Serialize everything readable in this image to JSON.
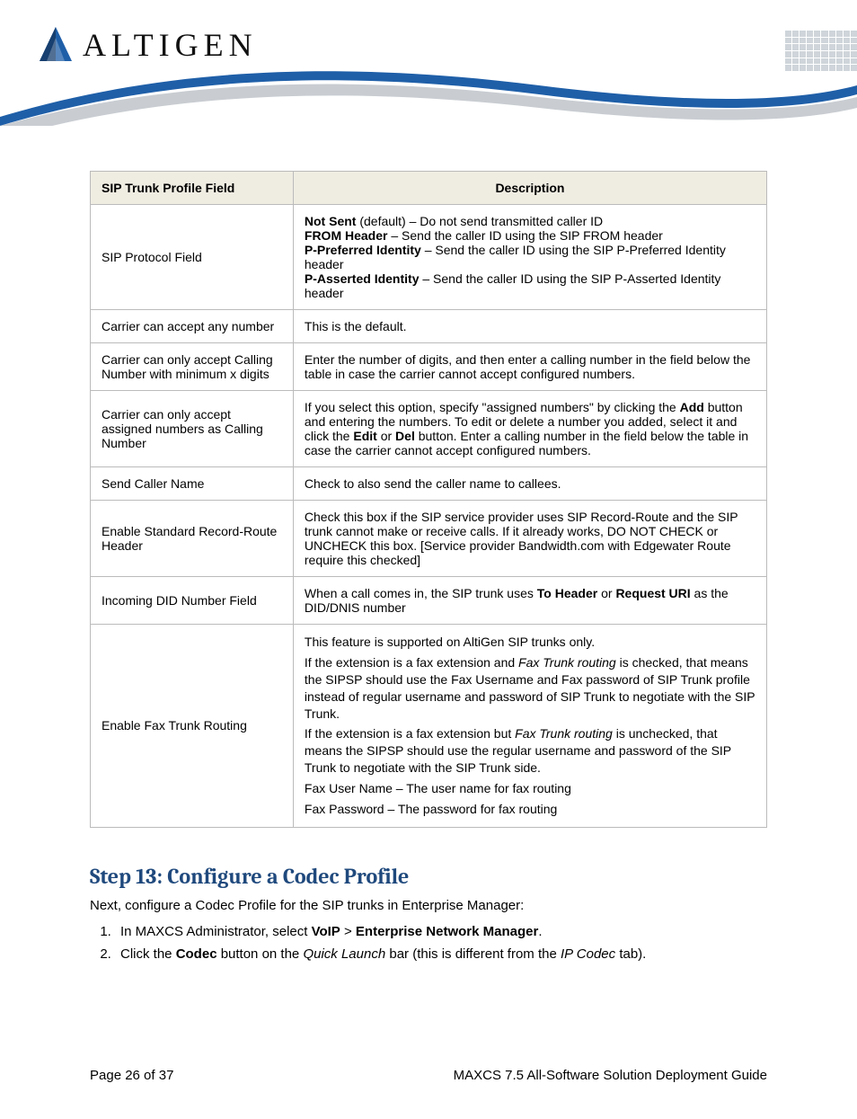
{
  "brand": {
    "name": "ALTIGEN"
  },
  "table": {
    "headers": [
      "SIP Trunk Profile Field",
      "Description"
    ],
    "rows": [
      {
        "field": "SIP Protocol Field",
        "desc": "<b>Not Sent</b> (default) – Do not send transmitted caller ID<br><b>FROM Header</b> – Send the caller ID using the SIP FROM header<br><b>P-Preferred Identity</b> – Send the caller ID using the SIP P-Preferred Identity header<br><b>P-Asserted Identity</b> – Send the caller ID using the SIP P-Asserted Identity header"
      },
      {
        "field": "Carrier can accept any number",
        "desc": "This is the default."
      },
      {
        "field": "Carrier can only accept Calling Number with minimum x digits",
        "desc": "Enter the number of digits, and then enter a calling number in the field below the table in case the carrier cannot accept configured numbers."
      },
      {
        "field": "Carrier can only accept assigned numbers as Calling Number",
        "desc": "If you select this option, specify \"assigned numbers\" by clicking the <b>Add</b> button and entering the numbers. To edit or delete a number you added, select it and click the <b>Edit</b> or <b>Del</b> button. Enter a calling number in the field below the table in case the carrier cannot accept configured numbers."
      },
      {
        "field": "Send Caller Name",
        "desc": "Check to also send the caller name to callees."
      },
      {
        "field": "Enable Standard Record-Route Header",
        "desc": "Check this box if the SIP service provider uses SIP Record-Route and the SIP trunk cannot make or receive calls. If it already works, DO NOT CHECK or UNCHECK this box. [Service provider Bandwidth.com with Edgewater Route require this checked]"
      },
      {
        "field": "Incoming DID Number Field",
        "desc": "When a call comes in, the SIP trunk uses <b>To Header</b> or <b>Request URI</b> as the DID/DNIS number"
      },
      {
        "field": "Enable Fax Trunk Routing",
        "desc": "<p>This feature is supported on AltiGen SIP trunks only.</p><p>If the extension is a fax extension and <i>Fax Trunk routing</i> is checked, that means the SIPSP should use the Fax Username and Fax password of SIP Trunk profile instead of regular username and password of SIP Trunk to negotiate with the SIP Trunk.</p><p>If the extension is a fax extension but <i>Fax Trunk routing</i> is unchecked, that means the SIPSP should use the regular username and password of the SIP Trunk to negotiate with the SIP Trunk side.</p><p>Fax User Name – The user name for fax routing</p><p>Fax Password – The password for fax routing</p>"
      }
    ]
  },
  "section": {
    "heading": "Step 13: Configure a Codec Profile",
    "intro": "Next, configure a Codec Profile for the SIP trunks in Enterprise Manager:",
    "items": [
      "In MAXCS Administrator, select <b>VoIP</b> > <b>Enterprise Network Manager</b>.",
      "Click the <b>Codec</b> button on the <i>Quick Launch</i> bar (this is different from the <i>IP Codec</i> tab)."
    ]
  },
  "footer": {
    "page": "Page 26 of 37",
    "doc": "MAXCS 7.5 All-Software Solution Deployment Guide"
  }
}
